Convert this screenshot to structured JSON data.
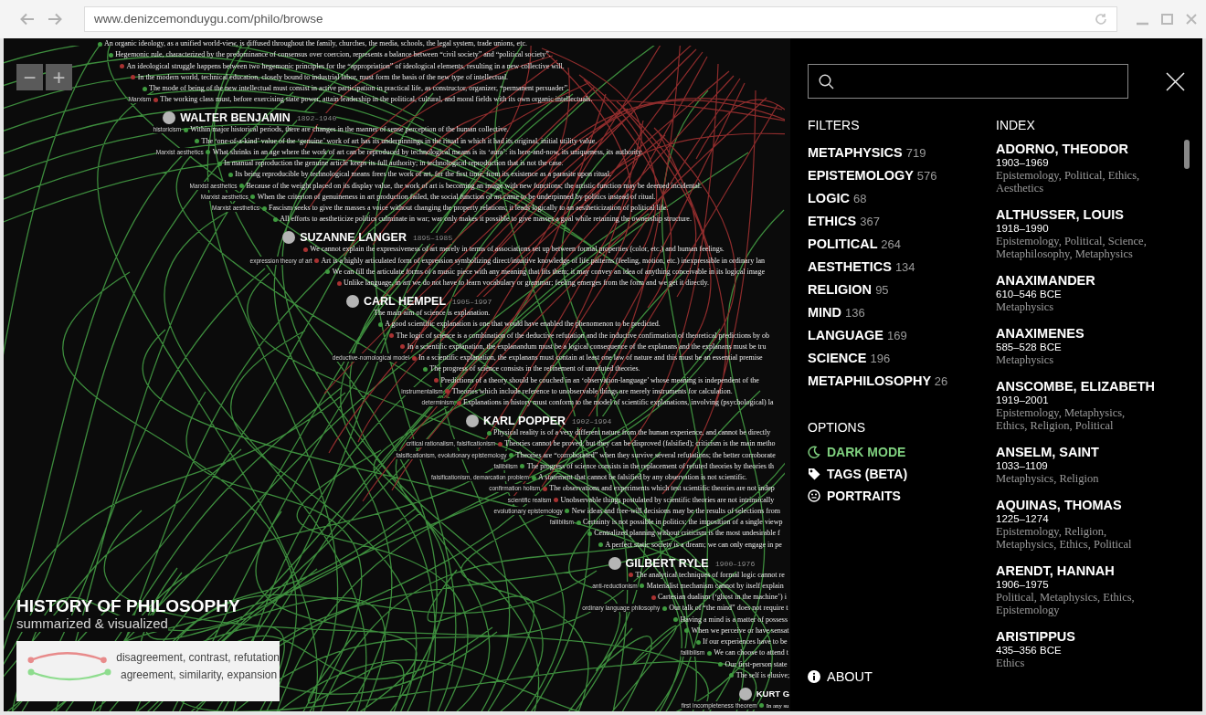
{
  "browser": {
    "url": "www.denizcemonduygu.com/philo/browse"
  },
  "canvas": {
    "zoom_buttons": [
      "−",
      "+"
    ],
    "philosophers": [
      {
        "statements": [
          {
            "text": "An organic ideology, as a unified world-view, is diffused throughout the family, churches, the media, schools, the legal system, trade unions, etc.",
            "color": "#3f9a3f"
          },
          {
            "text": "Hegemonic rule, characterized by the predominance of consensus over coercion, represents a balance between “civil society” and “political society”.",
            "color": "#3f9a3f"
          },
          {
            "text": "An ideological struggle happens between two hegemonic principles for the “appropriation” of ideological elements, resulting in a new collective will.",
            "color": "#a83232"
          },
          {
            "text": "In the modern world, technical education, closely bound to industrial labor, must form the basis of the new type of intellectual.",
            "color": "#a83232"
          },
          {
            "text": "The mode of being of the new intellectual must consist in active participation in practical life, as constructor, organizer, “permanent persuader”.",
            "color": "#3f9a3f"
          },
          {
            "tag": "Marxism",
            "text": "The working class must, before exercising state power, attain leadership in the political, cultural, and moral fields with its own organic intellectuals.",
            "color": "#a83232"
          }
        ]
      },
      {
        "name": "WALTER BENJAMIN",
        "years": "1892–1940",
        "statements": [
          {
            "tag": "historicism",
            "text": "Within major historical periods, there are changes in the manner of sense perception of the human collective.",
            "color": "#3f9a3f"
          },
          {
            "text": "The ‘one-of-a-kind’ value of the ‘genuine’ work of art has its underpinnings in the ritual in which it had its original, initial utility value.",
            "color": "#3f9a3f"
          },
          {
            "tag": "Marxist aesthetics",
            "text": "What shrinks in an age where the work of art can be reproduced by technological means is its ‘aura’: its here-and-now, its uniqueness, its authority.",
            "color": "#3f9a3f"
          },
          {
            "text": "In manual reproduction the genuine article keeps its full authority; in technological reproduction that is not the case.",
            "color": "#3f9a3f"
          },
          {
            "text": "Its being reproducible by technological means frees the work of art, for the first time, from its existence as a parasite upon ritual.",
            "color": "#3f9a3f"
          },
          {
            "tag": "Marxist aesthetics",
            "text": "Because of the weight placed on its display value, the work of art is becoming an image with new functions; the artistic function may be deemed incidental.",
            "color": "#3f9a3f"
          },
          {
            "tag": "Marxist aesthetics",
            "text": "When the criterion of genuineness in art production failed, the social function of art came to be underpinned by politics instead of ritual.",
            "color": "#3f9a3f"
          },
          {
            "tag": "Marxist aesthetics",
            "text": "Fascism seeks to give the masses a voice without changing the property relations; it leads logically to an aestheticization of political life.",
            "color": "#3f9a3f"
          },
          {
            "text": "All efforts to aestheticize politics culminate in war; war only makes it possible to give masses a goal while retaining the ownership structure.",
            "color": "#3f9a3f"
          }
        ]
      },
      {
        "name": "SUZANNE LANGER",
        "years": "1895–1985",
        "statements": [
          {
            "text": "We cannot explain the expressiveness of art merely in terms of associations set up between formal properties (color, etc.) and human feelings.",
            "color": "#a83232"
          },
          {
            "tag": "expression theory of art",
            "text": "Art is a highly articulated form of expression symbolizing direct/intuitive knowledge of life patterns (feeling, motion, etc.) inexpressible in ordinary lan",
            "color": "#a83232"
          },
          {
            "text": "We can fill the articulate forms of a music piece with any meaning that fits them; it may convey an idea of anything conceivable in its logical image",
            "color": "#3f9a3f"
          },
          {
            "text": "Unlike language, in art we do not have to learn vocabulary or grammar; feeling emerges from the form and we get it directly.",
            "color": "#a83232"
          }
        ]
      },
      {
        "name": "CARL HEMPEL",
        "years": "1905–1997",
        "statements": [
          {
            "text": "The main aim of science is explanation."
          },
          {
            "text": "A good scientific explanation is one that would have enabled the phenomenon to be predicted.",
            "color": "#3f9a3f"
          },
          {
            "text": "The logic of science is a combination of the deductive refutation and the inductive confirmation of theoretical predictions by ob",
            "color": "#a83232"
          },
          {
            "text": "In a scientific explanation, the explanandum must be a logical consequence of the explanans and the explanans must be tru",
            "color": "#a83232"
          },
          {
            "tag": "deductive-nomological model",
            "text": "In a scientific explanation, the explanans must contain at least one law of nature and this must be an essential premise",
            "color": "#a83232"
          },
          {
            "text": "The progress of science consists in the refinement of unrefuted theories.",
            "color": "#3f9a3f"
          },
          {
            "text": "Predictions of a theory should be couched in an ‘observation-language’ whose meaning is independent of the",
            "color": "#a83232"
          },
          {
            "tag": "instrumentalism",
            "text": "Theories which include reference to unobservable things are merely instruments for calculation.",
            "color": "#a83232"
          },
          {
            "tag": "determinism",
            "text": "Explanations in history must conform to the model of scientific explanations, involving (psychological) la",
            "color": "#a83232"
          }
        ]
      },
      {
        "name": "KARL POPPER",
        "years": "1902–1994",
        "statements": [
          {
            "text": "Physical reality is of a very different nature from the human experience, and cannot be directly",
            "color": "#3f9a3f"
          },
          {
            "tag": "critical rationalism, falsificationism",
            "text": "Theories cannot be proved, but they can be disproved (falsified); criticism is the main metho",
            "color": "#a83232"
          },
          {
            "tag": "falsificationism, evolutionary epistemology",
            "text": "Theories are “corroborated” when they survive several refutations; the better corroborate",
            "color": "#3f9a3f"
          },
          {
            "tag": "fallibilism",
            "text": "The progress of science consists in the replacement of refuted theories by theories th",
            "color": "#3f9a3f"
          },
          {
            "tag": "falsificationism, demarcation problem",
            "text": "A statement that cannot be falsified by any observation is not scientific.",
            "color": "#3f9a3f"
          },
          {
            "tag": "confirmation holism",
            "text": "The observations and experiments which test scientific theories are not indep",
            "color": "#a83232"
          },
          {
            "tag": "scientific realism",
            "text": "Unobservable things postulated by scientific theories are not intrinsically",
            "color": "#a83232"
          },
          {
            "tag": "evolutionary epistemology",
            "text": "New ideas and free-will decisions may be the results of selections from",
            "color": "#3f9a3f"
          },
          {
            "tag": "fallibilism",
            "text": "Certainty is not possible in politics; the imposition of a single viewp",
            "color": "#3f9a3f"
          },
          {
            "text": "Centralized planning without criticism is the most undesirable f",
            "color": "#3f9a3f"
          },
          {
            "text": "A perfect static society is a dream; we can only engage in pe",
            "color": "#3f9a3f"
          }
        ]
      },
      {
        "name": "GILBERT RYLE",
        "years": "1900–1976",
        "statements": [
          {
            "text": "The analytical techniques of formal logic cannot re",
            "color": "#a83232"
          },
          {
            "tag": "anti-reductionism",
            "text": "Materialist mechanism cannot by itself explain",
            "color": "#3f9a3f"
          },
          {
            "text": "Cartesian dualism (‘ghost in the machine’) i",
            "color": "#a83232"
          },
          {
            "tag": "ordinary language philosophy",
            "text": "Our talk of “the mind” does not require t",
            "color": "#3f9a3f"
          },
          {
            "text": "Having a mind is a matter of possess",
            "color": "#3f9a3f"
          },
          {
            "text": "When we perceive or have sensat",
            "color": "#3f9a3f"
          },
          {
            "text": "If our experiences have to be",
            "color": "#3f9a3f"
          },
          {
            "tag": "fallibilism",
            "text": "We can choose to attend t",
            "color": "#3f9a3f"
          },
          {
            "text": "Our first-person state",
            "color": "#3f9a3f"
          },
          {
            "text": "The self is elusive;",
            "color": "#3f9a3f"
          }
        ]
      },
      {
        "name": "KURT G",
        "statements": [
          {
            "tag": "first incompleteness theorem",
            "text": "In any su",
            "color": "#3f9a3f"
          }
        ]
      }
    ],
    "title": "HISTORY OF PHILOSOPHY",
    "subtitle": "summarized & visualized",
    "legend": [
      {
        "label": "disagreement, contrast, refutation",
        "color": "#e88b8b"
      },
      {
        "label": "agreement, similarity, expansion",
        "color": "#8edc8e"
      }
    ]
  },
  "panel": {
    "filters": {
      "heading": "FILTERS",
      "items": [
        {
          "label": "METAPHYSICS",
          "count": "719"
        },
        {
          "label": "EPISTEMOLOGY",
          "count": "576"
        },
        {
          "label": "LOGIC",
          "count": "68"
        },
        {
          "label": "ETHICS",
          "count": "367"
        },
        {
          "label": "POLITICAL",
          "count": "264"
        },
        {
          "label": "AESTHETICS",
          "count": "134"
        },
        {
          "label": "RELIGION",
          "count": "95"
        },
        {
          "label": "MIND",
          "count": "136"
        },
        {
          "label": "LANGUAGE",
          "count": "169"
        },
        {
          "label": "SCIENCE",
          "count": "196"
        },
        {
          "label": "METAPHILOSOPHY",
          "count": "26"
        }
      ]
    },
    "options": {
      "heading": "OPTIONS",
      "items": [
        {
          "kind": "moon",
          "label": "DARK MODE",
          "on": true
        },
        {
          "kind": "tag",
          "label": "TAGS (BETA)",
          "on": false
        },
        {
          "kind": "face",
          "label": "PORTRAITS",
          "on": false
        }
      ]
    },
    "about": "ABOUT",
    "index": {
      "heading": "INDEX",
      "items": [
        {
          "name": "ADORNO, THEODOR",
          "years": "1903–1969",
          "topics": "Epistemology, Political, Ethics, Aesthetics"
        },
        {
          "name": "ALTHUSSER, LOUIS",
          "years": "1918–1990",
          "topics": "Epistemology, Political, Science, Metaphilosophy, Metaphysics"
        },
        {
          "name": "ANAXIMANDER",
          "years": "610–546 BCE",
          "topics": "Metaphysics"
        },
        {
          "name": "ANAXIMENES",
          "years": "585–528 BCE",
          "topics": "Metaphysics"
        },
        {
          "name": "ANSCOMBE, ELIZABETH",
          "years": "1919–2001",
          "topics": "Epistemology, Metaphysics, Ethics, Religion, Political"
        },
        {
          "name": "ANSELM, SAINT",
          "years": "1033–1109",
          "topics": "Metaphysics, Religion"
        },
        {
          "name": "AQUINAS, THOMAS",
          "years": "1225–1274",
          "topics": "Epistemology, Religion, Metaphysics, Ethics, Political"
        },
        {
          "name": "ARENDT, HANNAH",
          "years": "1906–1975",
          "topics": "Political, Metaphysics, Ethics, Epistemology"
        },
        {
          "name": "ARISTIPPUS",
          "years": "435–356 BCE",
          "topics": "Ethics"
        }
      ]
    }
  }
}
